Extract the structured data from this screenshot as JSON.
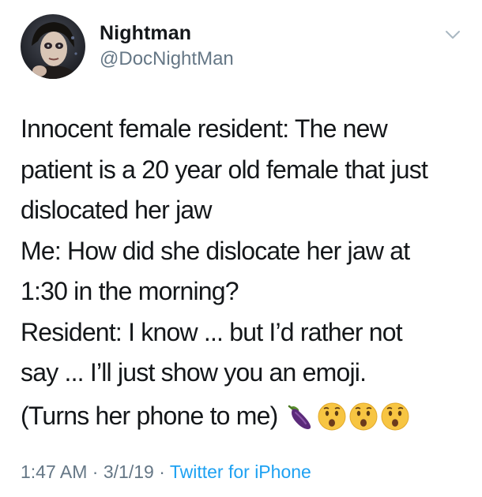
{
  "author": {
    "display_name": "Nightman",
    "handle": "@DocNightMan"
  },
  "tweet": {
    "lines": [
      "Innocent female resident: The new",
      "patient is a 20 year old female that just",
      "dislocated her jaw",
      "Me: How did she dislocate her jaw at",
      "1:30 in the morning?",
      "Resident: I know ... but I’d rather not",
      "say ... I’ll just show you an emoji."
    ],
    "last_line": "(Turns her phone to me)",
    "emojis": [
      "eggplant",
      "hushed-face",
      "hushed-face",
      "hushed-face"
    ]
  },
  "meta": {
    "time": "1:47 AM",
    "separator": "·",
    "date": "3/1/19",
    "source": "Twitter for iPhone"
  },
  "colors": {
    "text": "#14171a",
    "secondary": "#657786",
    "link": "#1da1f2"
  }
}
